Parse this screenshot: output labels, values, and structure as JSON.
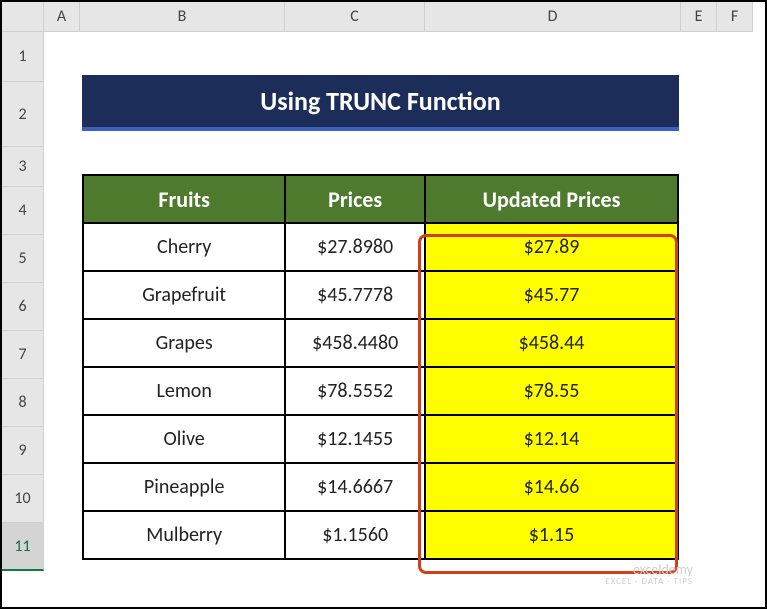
{
  "columns": [
    "A",
    "B",
    "C",
    "D",
    "E",
    "F"
  ],
  "rows": [
    "1",
    "2",
    "3",
    "4",
    "5",
    "6",
    "7",
    "8",
    "9",
    "10",
    "11"
  ],
  "selected_row": "11",
  "title": "Using TRUNC Function",
  "headers": {
    "fruits": "Fruits",
    "prices": "Prices",
    "updated": "Updated Prices"
  },
  "data": [
    {
      "fruit": "Cherry",
      "price": "$27.8980",
      "updated": "$27.89"
    },
    {
      "fruit": "Grapefruit",
      "price": "$45.7778",
      "updated": "$45.77"
    },
    {
      "fruit": "Grapes",
      "price": "$458.4480",
      "updated": "$458.44"
    },
    {
      "fruit": "Lemon",
      "price": "$78.5552",
      "updated": "$78.55"
    },
    {
      "fruit": "Olive",
      "price": "$12.1455",
      "updated": "$12.14"
    },
    {
      "fruit": "Pineapple",
      "price": "$14.6667",
      "updated": "$14.66"
    },
    {
      "fruit": "Mulberry",
      "price": "$1.1560",
      "updated": "$1.15"
    }
  ],
  "watermark": {
    "main": "exceldemy",
    "sub": "EXCEL · DATA · TIPS"
  },
  "chart_data": {
    "type": "table",
    "title": "Using TRUNC Function",
    "columns": [
      "Fruits",
      "Prices",
      "Updated Prices"
    ],
    "rows": [
      [
        "Cherry",
        27.898,
        27.89
      ],
      [
        "Grapefruit",
        45.7778,
        45.77
      ],
      [
        "Grapes",
        458.448,
        458.44
      ],
      [
        "Lemon",
        78.5552,
        78.55
      ],
      [
        "Olive",
        12.1455,
        12.14
      ],
      [
        "Pineapple",
        14.6667,
        14.66
      ],
      [
        "Mulberry",
        1.156,
        1.15
      ]
    ]
  }
}
